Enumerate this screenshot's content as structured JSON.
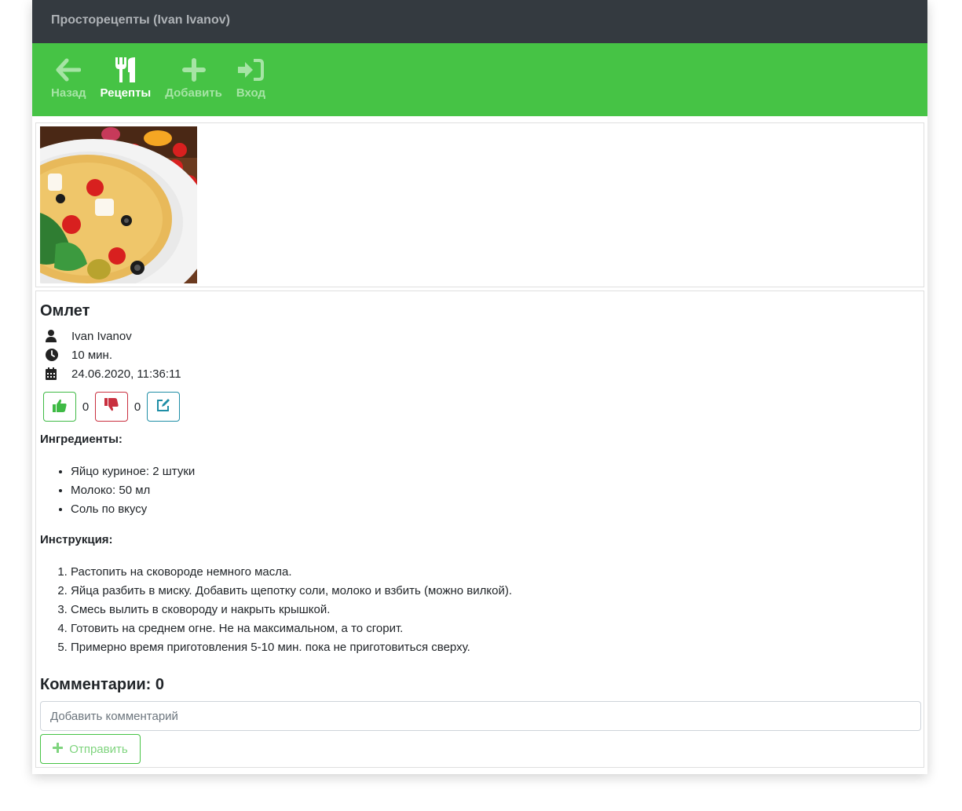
{
  "app": {
    "title": "Просторецепты (Ivan Ivanov)"
  },
  "nav": {
    "back": {
      "label": "Назад",
      "icon": "arrow-left-icon"
    },
    "recipes": {
      "label": "Рецепты",
      "icon": "utensils-icon"
    },
    "add": {
      "label": "Добавить",
      "icon": "plus-icon"
    },
    "login": {
      "label": "Вход",
      "icon": "sign-in-icon"
    }
  },
  "recipe": {
    "title": "Омлет",
    "author": "Ivan Ivanov",
    "time": "10 мин.",
    "date": "24.06.2020, 11:36:11",
    "likes": "0",
    "dislikes": "0",
    "ingredients_heading": "Ингредиенты:",
    "ingredients": [
      "Яйцо куриное: 2 штуки",
      "Молоко: 50 мл",
      "Соль по вкусу"
    ],
    "instructions_heading": "Инструкция:",
    "instructions": [
      "Растопить на сковороде немного масла.",
      "Яйца разбить в миску. Добавить щепотку соли, молоко и взбить (можно вилкой).",
      "Смесь вылить в сковороду и накрыть крышкой.",
      "Готовить на среднем огне. Не на максимальном, а то сгорит.",
      "Примерно время приготовления 5-10 мин. пока не приготовиться сверху."
    ]
  },
  "comments": {
    "heading": "Комментарии: 0",
    "placeholder": "Добавить комментарий",
    "send_label": "Отправить"
  },
  "colors": {
    "header": "#343a40",
    "navbar": "#46c345",
    "like": "#3fba45",
    "dislike": "#c9303f",
    "edit": "#1f8ea6"
  }
}
